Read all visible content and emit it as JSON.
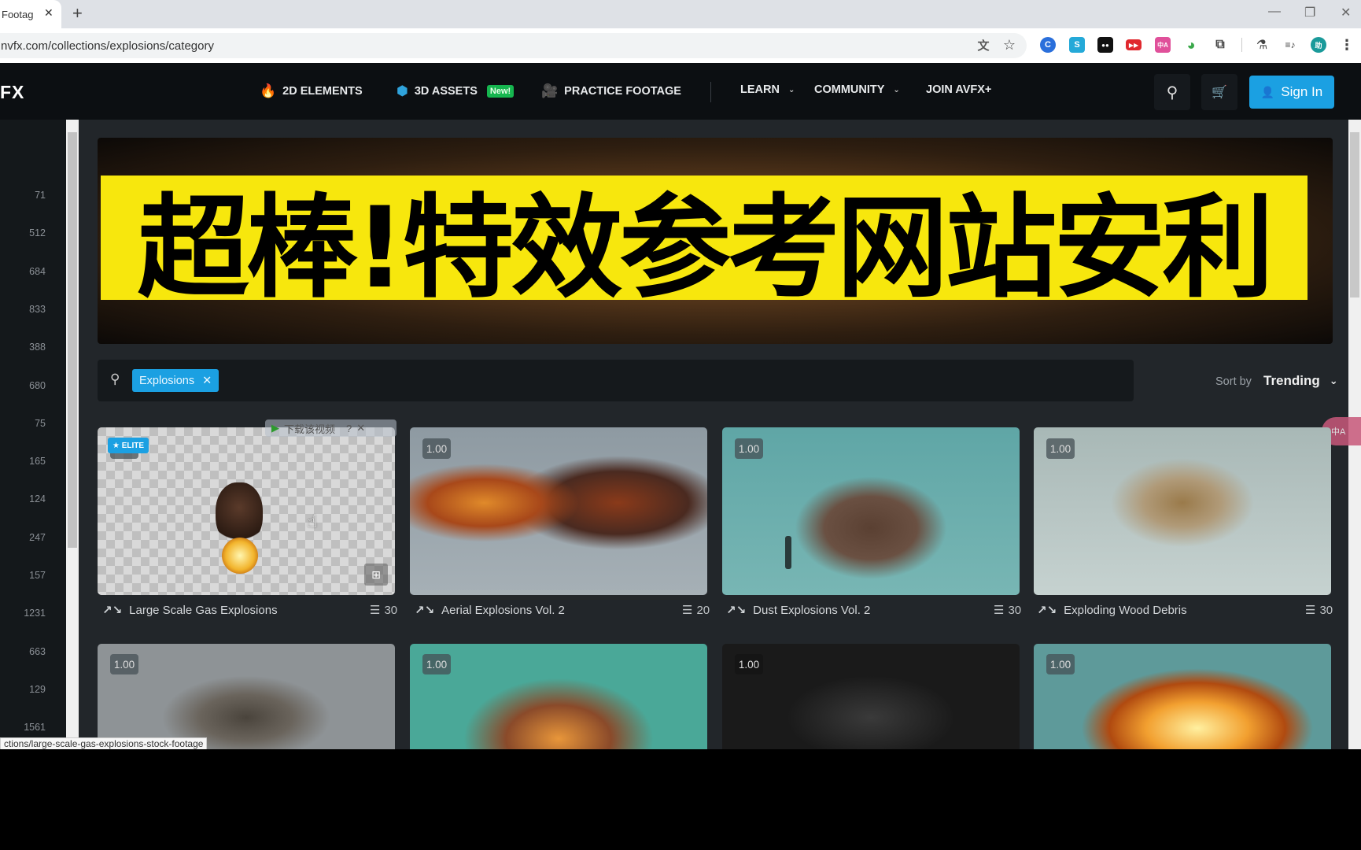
{
  "browser": {
    "tab_title": "Footag",
    "tab_close": "✕",
    "new_tab": "+",
    "url": "nvfx.com/collections/explosions/category",
    "status_url": "ctions/large-scale-gas-explosions-stock-footage",
    "window_controls": {
      "minimize": "—",
      "restore": "❐",
      "close": "✕"
    },
    "extensions": [
      {
        "name": "translate-icon",
        "glyph": "文"
      },
      {
        "name": "bookmark-star-icon",
        "glyph": "☆"
      },
      {
        "name": "blue-c-extension-icon",
        "glyph": "C",
        "color": "#2a6fdb"
      },
      {
        "name": "s-extension-icon",
        "glyph": "S",
        "color": "#24a9d8"
      },
      {
        "name": "black-extension-icon",
        "glyph": "●●",
        "color": "#111111"
      },
      {
        "name": "red-play-extension-icon",
        "glyph": "▶▶",
        "color": "#e0282e"
      },
      {
        "name": "pink-translate-extension-icon",
        "glyph": "中A",
        "color": "#e0509a"
      },
      {
        "name": "globe-extension-icon",
        "glyph": "◕",
        "color": "#3aa84a"
      },
      {
        "name": "puzzle-extensions-icon",
        "glyph": "⧉"
      },
      {
        "name": "labs-flask-icon",
        "glyph": "⚗"
      },
      {
        "name": "media-queue-icon",
        "glyph": "≡♪"
      },
      {
        "name": "profile-avatar",
        "glyph": "助",
        "color": "#1a9a9a"
      },
      {
        "name": "menu-kebab-icon",
        "glyph": "⋮"
      }
    ]
  },
  "nav": {
    "logo": "FX",
    "items": [
      {
        "label": "2D ELEMENTS",
        "icon": "🔥"
      },
      {
        "label": "3D ASSETS",
        "icon": "⬢",
        "badge": "New!"
      },
      {
        "label": "PRACTICE FOOTAGE",
        "icon": "🎥"
      }
    ],
    "dropdowns": [
      {
        "label": "LEARN",
        "chevron": "⌄"
      },
      {
        "label": "COMMUNITY",
        "chevron": "⌄"
      }
    ],
    "join": "JOIN AVFX+",
    "search_glyph": "⚲",
    "cart_glyph": "🛒",
    "sign_in": "Sign In",
    "user_glyph": "👤",
    "accent_color": "#1ba0e2"
  },
  "gutter_numbers": [
    "71",
    "512",
    "684",
    "833",
    "388",
    "680",
    "75",
    "165",
    "124",
    "247",
    "157",
    "1231",
    "663",
    "129",
    "1561"
  ],
  "banner": {
    "overlay_text": "超棒!特效参考网站安利",
    "overlay_bg": "#f7e70d"
  },
  "search": {
    "glyph": "⚲",
    "chip_label": "Explosions",
    "chip_remove": "✕"
  },
  "sort": {
    "label": "Sort by",
    "value": "Trending",
    "chevron": "⌄"
  },
  "translate_fab": "中A",
  "download_overlay": {
    "label": "下载该视频",
    "help": "?",
    "close": "✕"
  },
  "elite_badge": "★ ELITE",
  "cards_row1": [
    {
      "title": "Large Scale Gas Explosions",
      "count": "30",
      "rating": "1.00"
    },
    {
      "title": "Aerial Explosions Vol. 2",
      "count": "20",
      "rating": "1.00"
    },
    {
      "title": "Dust Explosions Vol. 2",
      "count": "30",
      "rating": "1.00"
    },
    {
      "title": "Exploding Wood Debris",
      "count": "30",
      "rating": "1.00"
    }
  ],
  "cards_row2": [
    {
      "rating": "1.00"
    },
    {
      "rating": "1.00"
    },
    {
      "rating": "1.00"
    },
    {
      "rating": "1.00"
    }
  ],
  "glyphs": {
    "wave": "↗↘",
    "stack": "☰",
    "folder_add": "⊞",
    "cursor": "☝"
  }
}
